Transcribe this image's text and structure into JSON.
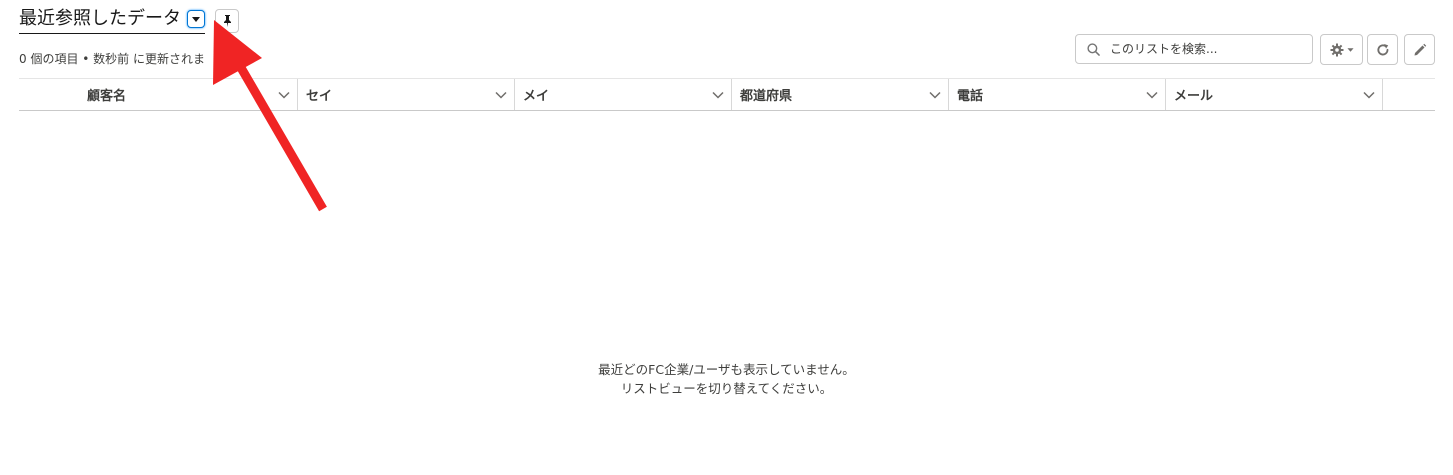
{
  "header": {
    "title": "最近参照したデータ",
    "meta": "0 個の項目 • 数秒前 に更新されま"
  },
  "toolbar": {
    "search_placeholder": "このリストを検索...",
    "icons": {
      "search": "search-icon",
      "settings": "gear-icon",
      "refresh": "refresh-icon",
      "edit": "pencil-icon",
      "pin": "pin-icon",
      "dropdown": "caret-down-icon"
    }
  },
  "table": {
    "columns": [
      "顧客名",
      "セイ",
      "メイ",
      "都道府県",
      "電話",
      "メール"
    ]
  },
  "empty_state": {
    "line1": "最近どのFC企業/ユーザも表示していません。",
    "line2": "リストビューを切り替えてください。"
  },
  "colors": {
    "accent": "#0176d3",
    "annotation_arrow": "#f02424",
    "text": "#3e3e3c"
  }
}
